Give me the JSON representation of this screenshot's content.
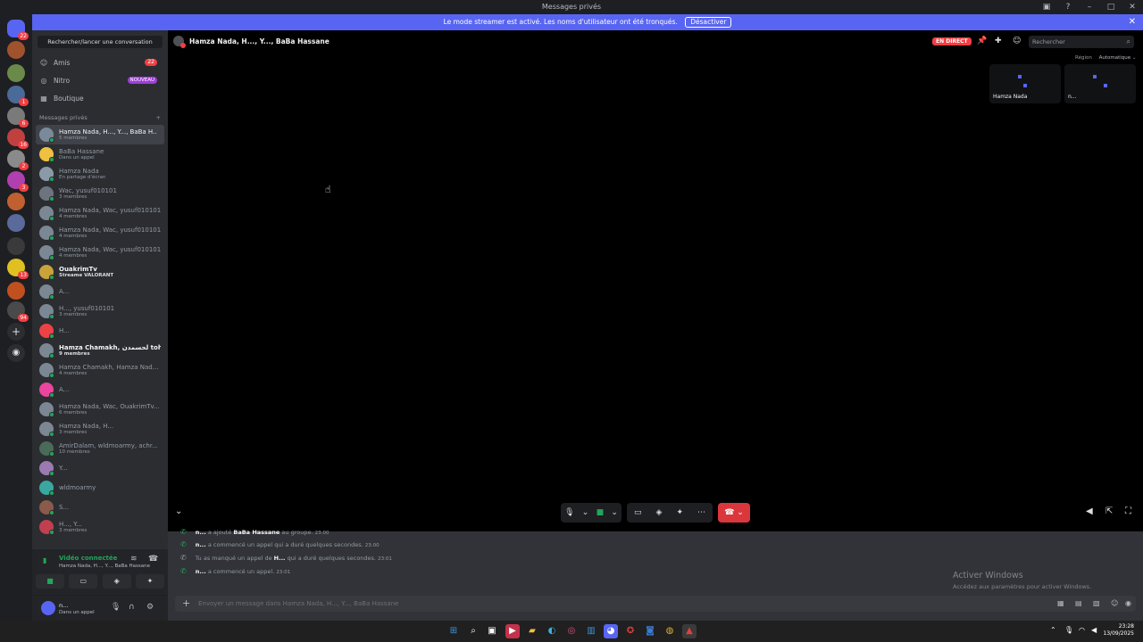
{
  "window": {
    "title": "Messages privés"
  },
  "banner": {
    "text": "Le mode streamer est activé. Les noms d'utilisateur ont été tronqués.",
    "button": "Désactiver"
  },
  "guilds": {
    "home_badge": "22",
    "badges": [
      "",
      "",
      "1",
      "6",
      "16",
      "2",
      "3",
      "",
      "",
      "",
      "13",
      "",
      "94"
    ]
  },
  "sidebar": {
    "search": "Rechercher/lancer une conversation",
    "nav": [
      {
        "label": "Amis",
        "icon": "friends-icon",
        "badge": "22"
      },
      {
        "label": "Nitro",
        "icon": "nitro-icon",
        "badge": "NOUVEAU"
      },
      {
        "label": "Boutique",
        "icon": "shop-icon",
        "badge": ""
      }
    ],
    "dm_header": "Messages privés",
    "dms": [
      {
        "name": "Hamza Nada, H..., Y..., BaBa H...",
        "sub": "5 membres",
        "color": "#7a8a9a",
        "active": true
      },
      {
        "name": "BaBa Hassane",
        "sub": "Dans un appel",
        "color": "#f0c040"
      },
      {
        "name": "Hamza Nada",
        "sub": "En partage d'écran",
        "color": "#8a9aa8"
      },
      {
        "name": "Wac, yusuf010101",
        "sub": "3 membres",
        "color": "#6d7480"
      },
      {
        "name": "Hamza Nada, Wac, yusuf010101",
        "sub": "4 membres",
        "color": "#7c8794"
      },
      {
        "name": "Hamza Nada, Wac, yusuf010101",
        "sub": "4 membres",
        "color": "#7c8794"
      },
      {
        "name": "Hamza Nada, Wac, yusuf010101",
        "sub": "4 membres",
        "color": "#7c8794"
      },
      {
        "name": "OuakrimTv",
        "sub": "Streame VALORANT",
        "color": "#c9a23a",
        "bright": true
      },
      {
        "name": "A...",
        "sub": "",
        "color": "#7c8794"
      },
      {
        "name": "H..., yusuf010101",
        "sub": "3 membres",
        "color": "#7c8794"
      },
      {
        "name": "H...",
        "sub": "",
        "color": "#ed4245"
      },
      {
        "name": "Hamza Chamakh, لحسمدن toh...",
        "sub": "9 membres",
        "color": "#7c8794",
        "bright": true
      },
      {
        "name": "Hamza Chamakh, Hamza Nad...",
        "sub": "4 membres",
        "color": "#7c8794"
      },
      {
        "name": "A...",
        "sub": "",
        "color": "#eb459e"
      },
      {
        "name": "Hamza Nada, Wac, OuakrimTv...",
        "sub": "6 membres",
        "color": "#7c8794"
      },
      {
        "name": "Hamza Nada, H...",
        "sub": "3 membres",
        "color": "#7c8794"
      },
      {
        "name": "AmirDalam, wldmoarmy, achr...",
        "sub": "10 membres",
        "color": "#4a6a5a"
      },
      {
        "name": "Y...",
        "sub": "",
        "color": "#9a7ab0"
      },
      {
        "name": "wldmoarmy",
        "sub": "",
        "color": "#3aa8a0"
      },
      {
        "name": "S...",
        "sub": "",
        "color": "#8a5a4a"
      },
      {
        "name": "H..., Y...",
        "sub": "3 membres",
        "color": "#c04050"
      }
    ],
    "voice": {
      "title": "Vidéo connectée",
      "channel": "Hamza Nada, H..., Y..., BaBa Hassane"
    },
    "user": {
      "name": "n...",
      "status": "Dans un appel"
    }
  },
  "call": {
    "title": "Hamza Nada, H..., Y..., BaBa Hassane",
    "live": "EN DIRECT",
    "search_placeholder": "Rechercher",
    "region_label": "Région",
    "region_value": "Automatique",
    "tiles": [
      "Hamza Nada",
      "n..."
    ]
  },
  "chat": {
    "messages": [
      {
        "author": "n...",
        "text": "a ajouté",
        "target": "BaBa Hassane",
        "rest": "au groupe.",
        "time": "23:00",
        "missed": false
      },
      {
        "author": "n...",
        "text": "a commencé un appel qui a duré quelques secondes.",
        "target": "",
        "rest": "",
        "time": "23:00",
        "missed": false
      },
      {
        "author": "",
        "text": "Tu as manqué un appel de",
        "target": "H...",
        "rest": "qui a duré quelques secondes.",
        "time": "23:01",
        "missed": true
      },
      {
        "author": "n...",
        "text": "a commencé un appel.",
        "target": "",
        "rest": "",
        "time": "23:01",
        "missed": false
      }
    ],
    "composer_placeholder": "Envoyer un message dans Hamza Nada, H..., Y..., BaBa Hassane",
    "activate_title": "Activer Windows",
    "activate_sub": "Accédez aux paramètres pour activer Windows."
  },
  "taskbar": {
    "time": "23:28",
    "date": "13/09/2025"
  }
}
